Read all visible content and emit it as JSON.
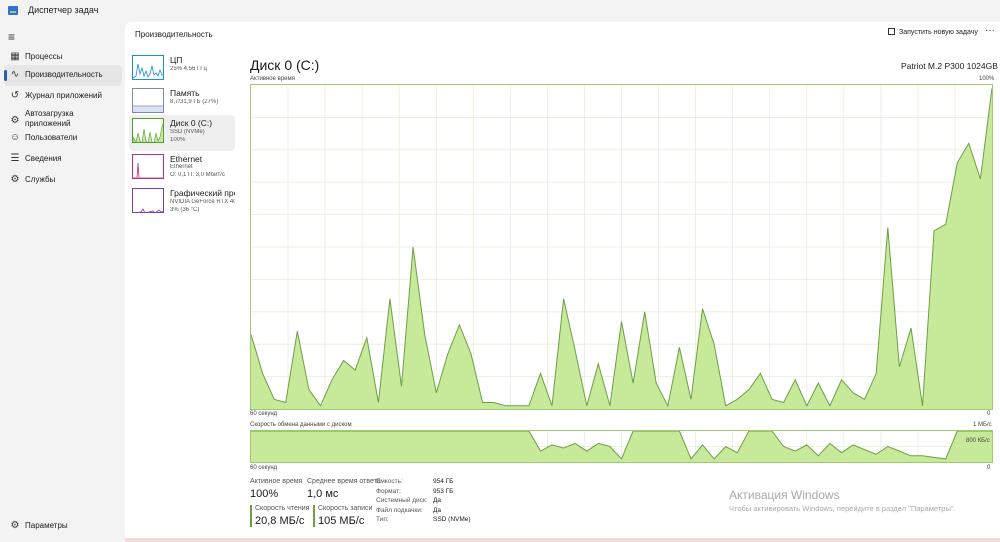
{
  "window": {
    "title": "Диспетчер задач"
  },
  "sidebar": {
    "items": [
      {
        "label": "Процессы",
        "icon": "processes-icon",
        "active": false
      },
      {
        "label": "Производительность",
        "icon": "performance-icon",
        "active": true
      },
      {
        "label": "Журнал приложений",
        "icon": "history-icon",
        "active": false
      },
      {
        "label": "Автозагрузка приложений",
        "icon": "startup-icon",
        "active": false
      },
      {
        "label": "Пользователи",
        "icon": "users-icon",
        "active": false
      },
      {
        "label": "Сведения",
        "icon": "details-icon",
        "active": false
      },
      {
        "label": "Службы",
        "icon": "services-icon",
        "active": false
      }
    ],
    "settings_label": "Параметры"
  },
  "header": {
    "title": "Производительность",
    "run_task": "Запустить новую задачу",
    "more": "···"
  },
  "resources": [
    {
      "name": "ЦП",
      "sub1": "25% 4,56 ГГц",
      "sub2": "",
      "sub3": "",
      "color": "#1a8fd6"
    },
    {
      "name": "Память",
      "sub1": "8,7/31,9 ГБ (27%)",
      "sub2": "",
      "sub3": "",
      "color": "#7a8bb8"
    },
    {
      "name": "Диск 0 (C:)",
      "sub1": "SSD (NVMe)",
      "sub2": "100%",
      "sub3": "",
      "color": "#4f9e2f"
    },
    {
      "name": "Ethernet",
      "sub1": "Ethernet",
      "sub2": "О: 0,1 П: 3,0 Мбит/с",
      "sub3": "",
      "color": "#b5327f"
    },
    {
      "name": "Графический про",
      "sub1": "NVIDIA GeForce RTX 406",
      "sub2": "3% (36 °C)",
      "sub3": "",
      "color": "#7a3fb8"
    }
  ],
  "disk": {
    "title": "Диск 0 (C:)",
    "model": "Patriot M.2 P300 1024GB",
    "active_time_label": "Активное время",
    "active_time_max": "100%",
    "graph1_time": "60 секунд",
    "graph1_min": "0",
    "transfer_label": "Скорость обмена данными с диском",
    "transfer_max": "1 МБ/с",
    "transfer_mid": "800 КБ/с",
    "graph2_time": "60 секунд",
    "graph2_min": "0"
  },
  "stats": {
    "active_time_label": "Активное время",
    "active_time_value": "100%",
    "avg_response_label": "Среднее время ответа",
    "avg_response_value": "1,0 мс",
    "read_label": "Скорость чтения",
    "read_value": "20,8 МБ/с",
    "write_label": "Скорость записи",
    "write_value": "105 МБ/с"
  },
  "properties": [
    {
      "key": "Емкость:",
      "value": "954 ГБ"
    },
    {
      "key": "Формат:",
      "value": "953 ГБ"
    },
    {
      "key": "Системный диск:",
      "value": "Да"
    },
    {
      "key": "Файл подкачки:",
      "value": "Да"
    },
    {
      "key": "Тип:",
      "value": "SSD (NVMe)"
    }
  ],
  "watermark": {
    "title": "Активация Windows",
    "text": "Чтобы активировать Windows, перейдите в раздел \"Параметры\"."
  },
  "chart_data": [
    {
      "type": "area",
      "title": "Активное время",
      "ylim": [
        0,
        100
      ],
      "x_range_label": "60 секунд",
      "values": [
        23,
        11,
        3,
        2,
        24,
        6,
        1,
        9,
        15,
        12,
        22,
        2,
        34,
        7,
        50,
        23,
        5,
        17,
        26,
        17,
        2,
        2,
        1,
        1,
        1,
        11,
        1,
        34,
        18,
        1,
        14,
        1,
        27,
        8,
        30,
        8,
        1,
        19,
        3,
        31,
        20,
        1,
        3,
        6,
        11,
        3,
        2,
        9,
        1,
        8,
        1,
        9,
        5,
        3,
        11,
        56,
        13,
        25,
        1,
        55,
        57,
        76,
        82,
        71,
        99
      ],
      "color": "#c6ea9a",
      "line_color": "#6f9e45",
      "grid": true
    },
    {
      "type": "area",
      "title": "Скорость обмена данными с диском",
      "ylim": [
        0,
        1
      ],
      "x_range_label": "60 секунд",
      "values": [
        1,
        1,
        1,
        1,
        1,
        1,
        1,
        1,
        1,
        1,
        1,
        1,
        1,
        1,
        1,
        1,
        1,
        1,
        1,
        1,
        1,
        1,
        1,
        1,
        1,
        0.35,
        0.55,
        0.45,
        0.6,
        0.35,
        0.6,
        0.5,
        0.1,
        1,
        1,
        1,
        1,
        1,
        0.1,
        0.55,
        0.1,
        0.5,
        0.3,
        1,
        1,
        1,
        0.5,
        0.35,
        0.55,
        0.2,
        0.6,
        0.3,
        0.55,
        0.4,
        0.25,
        0.5,
        0.35,
        0.2,
        0.2,
        0.15,
        0.1,
        1,
        1,
        1,
        1
      ],
      "color": "#c6ea9a",
      "line_color": "#6f9e45",
      "grid": true
    }
  ]
}
